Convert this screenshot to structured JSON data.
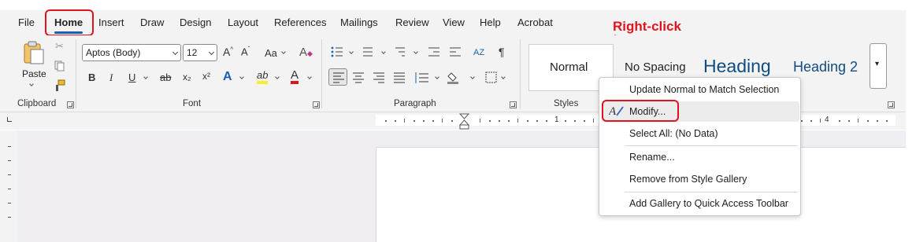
{
  "tabs": [
    "File",
    "Home",
    "Insert",
    "Draw",
    "Design",
    "Layout",
    "References",
    "Mailings",
    "Review",
    "View",
    "Help",
    "Acrobat"
  ],
  "clipboard": {
    "paste_label": "Paste",
    "group_label": "Clipboard"
  },
  "font": {
    "name": "Aptos (Body)",
    "size": "12",
    "group_label": "Font",
    "grow": "A^",
    "shrink": "A˅",
    "case": "Aa",
    "bold": "B",
    "italic": "I",
    "underline": "U",
    "strike": "ab",
    "subscript": "x₂",
    "superscript": "x²",
    "effects": "A",
    "highlight": "ab",
    "color": "A"
  },
  "paragraph": {
    "group_label": "Paragraph"
  },
  "styles": {
    "group_label": "Styles",
    "items": [
      "Normal",
      "No Spacing",
      "Heading",
      "Heading 2"
    ]
  },
  "annotation": "Right-click",
  "ruler": {
    "num1": "1",
    "num4": "4"
  },
  "context_menu": {
    "items": [
      "Update Normal to Match Selection",
      "Modify...",
      "Select All: (No Data)",
      "Rename...",
      "Remove from Style Gallery",
      "Add Gallery to Quick Access Toolbar"
    ]
  },
  "colors": {
    "accent": "#1a5fb4",
    "annotation_red": "#e0141e",
    "heading_blue": "#0f4c81"
  }
}
